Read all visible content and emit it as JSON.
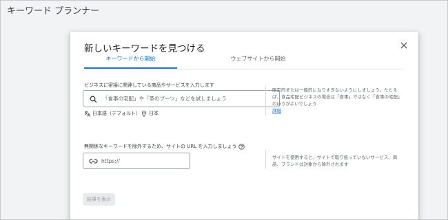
{
  "page": {
    "title": "キーワード プランナー"
  },
  "dialog": {
    "title": "新しいキーワードを見つける",
    "tabs": [
      {
        "label": "キーワードから開始",
        "active": true
      },
      {
        "label": "ウェブサイトから開始",
        "active": false
      }
    ],
    "keywords": {
      "label": "ビジネスに密接に関連している商品やサービスを入力します",
      "placeholder": "「食事の宅配」や「革のブーツ」などを試しましょう",
      "language": "日本語（デフォルト）",
      "location": "日本",
      "help_text": "限定的または一般的になりすぎないようにしましょう。たとえば、食品宅配ビジネスの場合は「食事」ではなく「食事の宅配」のほうがよいでしょう",
      "help_link": "詳細"
    },
    "exclude": {
      "label": "無関係なキーワードを除外するため、サイトの URL を入力しましょう",
      "placeholder": "https://",
      "help_text": "サイトを使用すると、サイトで取り扱っていないサービス、商品、ブランドは対象から除外されます"
    },
    "submit_label": "結果を表示"
  },
  "colors": {
    "accent": "#1a73e8",
    "disabled_bg": "#e8eaed",
    "disabled_text": "#9aa0a6"
  }
}
